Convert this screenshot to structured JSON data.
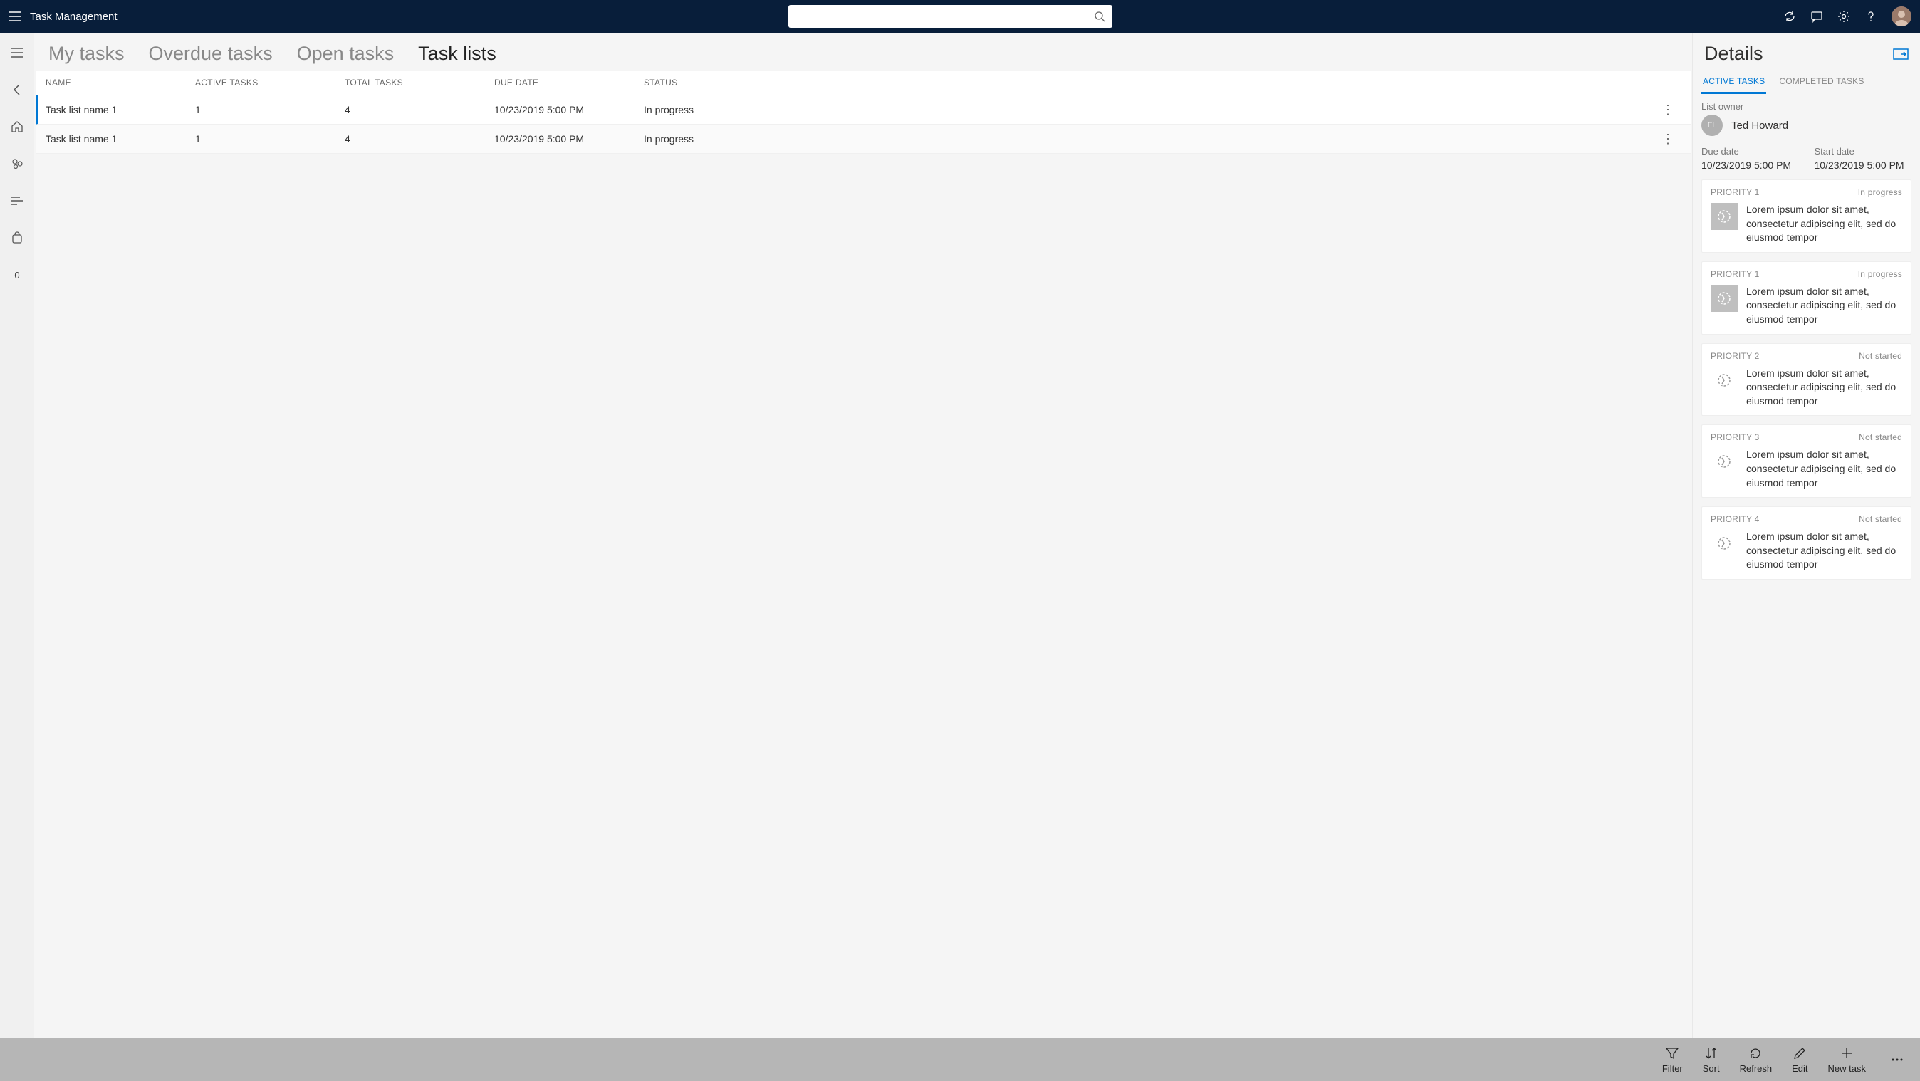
{
  "app_title": "Task Management",
  "search": {
    "placeholder": ""
  },
  "tabs": [
    {
      "label": "My tasks"
    },
    {
      "label": "Overdue tasks"
    },
    {
      "label": "Open tasks"
    },
    {
      "label": "Task lists"
    }
  ],
  "active_tab_index": 3,
  "table": {
    "columns": {
      "name": "NAME",
      "active": "ACTIVE TASKS",
      "total": "TOTAL TASKS",
      "due": "DUE DATE",
      "status": "STATUS"
    },
    "rows": [
      {
        "name": "Task list name 1",
        "active": "1",
        "total": "4",
        "due": "10/23/2019 5:00 PM",
        "status": "In progress"
      },
      {
        "name": "Task list name 1",
        "active": "1",
        "total": "4",
        "due": "10/23/2019 5:00 PM",
        "status": "In progress"
      }
    ]
  },
  "rail_zero": "0",
  "details": {
    "title": "Details",
    "tabs": {
      "active": "ACTIVE TASKS",
      "completed": "COMPLETED TASKS"
    },
    "owner_label": "List owner",
    "owner_initials": "FL",
    "owner_name": "Ted Howard",
    "due_label": "Due date",
    "due_value": "10/23/2019 5:00 PM",
    "start_label": "Start date",
    "start_value": "10/23/2019 5:00 PM",
    "tasks": [
      {
        "priority": "PRIORITY 1",
        "status": "In progress",
        "desc": "Lorem ipsum dolor sit amet, consectetur adipiscing elit, sed do eiusmod tempor",
        "filled": true
      },
      {
        "priority": "PRIORITY 1",
        "status": "In progress",
        "desc": "Lorem ipsum dolor sit amet, consectetur adipiscing elit, sed do eiusmod tempor",
        "filled": true
      },
      {
        "priority": "PRIORITY 2",
        "status": "Not started",
        "desc": "Lorem ipsum dolor sit amet, consectetur adipiscing elit, sed do eiusmod tempor",
        "filled": false
      },
      {
        "priority": "PRIORITY 3",
        "status": "Not started",
        "desc": "Lorem ipsum dolor sit amet, consectetur adipiscing elit, sed do eiusmod tempor",
        "filled": false
      },
      {
        "priority": "PRIORITY 4",
        "status": "Not started",
        "desc": "Lorem ipsum dolor sit amet, consectetur adipiscing elit, sed do eiusmod tempor",
        "filled": false
      }
    ]
  },
  "bottombar": {
    "filter": "Filter",
    "sort": "Sort",
    "refresh": "Refresh",
    "edit": "Edit",
    "newtask": "New task"
  }
}
